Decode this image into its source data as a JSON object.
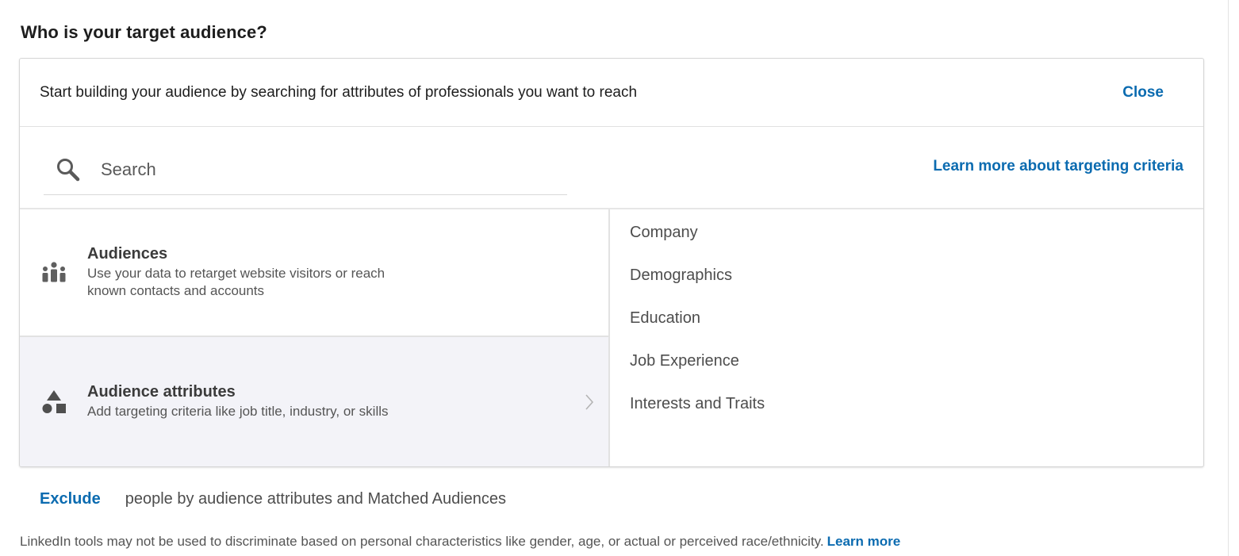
{
  "heading": "Who is your target audience?",
  "panel": {
    "intro": "Start building your audience by searching for attributes of professionals you want to reach",
    "close_label": "Close",
    "search": {
      "placeholder": "Search",
      "value": ""
    },
    "learn_targeting_label": "Learn more about targeting criteria",
    "options": [
      {
        "title": "Audiences",
        "description": "Use your data to retarget website visitors or reach known contacts and accounts",
        "icon": "people-icon"
      },
      {
        "title": "Audience attributes",
        "description": "Add targeting criteria like job title, industry, or skills",
        "icon": "shapes-icon",
        "selected": true
      }
    ],
    "categories": [
      "Company",
      "Demographics",
      "Education",
      "Job Experience",
      "Interests and Traits"
    ]
  },
  "exclude": {
    "link_label": "Exclude",
    "text": "people by audience attributes and Matched Audiences"
  },
  "disclaimer": {
    "text": "LinkedIn tools may not be used to discriminate based on personal characteristics like gender, age, or actual or perceived race/ethnicity.",
    "link_label": "Learn more"
  },
  "colors": {
    "link": "#0b6bb0",
    "selected_bg": "#f3f3f8"
  }
}
